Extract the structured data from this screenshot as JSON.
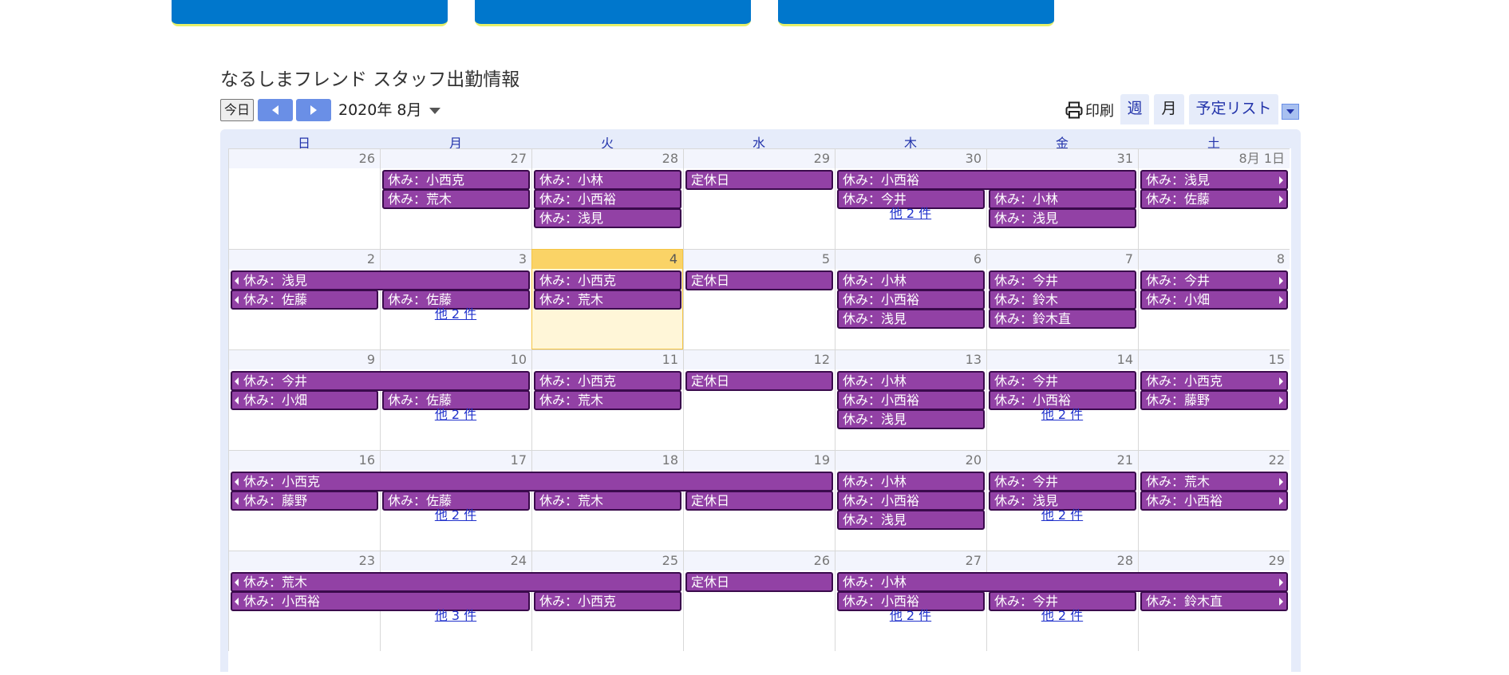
{
  "header": {
    "calendar_title": "なるしまフレンド スタッフ出勤情報"
  },
  "toolbar": {
    "today_label": "今日",
    "month_label": "2020年 8月",
    "print_label": "印刷",
    "week_label": "週",
    "month_view_label": "月",
    "agenda_label": "予定リスト"
  },
  "weekdays": [
    "日",
    "月",
    "火",
    "水",
    "木",
    "金",
    "土"
  ],
  "weeks": [
    {
      "days": [
        "26",
        "27",
        "28",
        "29",
        "30",
        "31",
        "8月 1日"
      ],
      "events": [
        {
          "col": 1,
          "span": 1,
          "row": 0,
          "label": "休み：小西克"
        },
        {
          "col": 1,
          "span": 1,
          "row": 1,
          "label": "休み：荒木"
        },
        {
          "col": 2,
          "span": 1,
          "row": 0,
          "label": "休み：小林"
        },
        {
          "col": 2,
          "span": 1,
          "row": 1,
          "label": "休み：小西裕"
        },
        {
          "col": 2,
          "span": 1,
          "row": 2,
          "label": "休み：浅見"
        },
        {
          "col": 3,
          "span": 1,
          "row": 0,
          "label": "定休日"
        },
        {
          "col": 4,
          "span": 2,
          "row": 0,
          "label": "休み：小西裕"
        },
        {
          "col": 4,
          "span": 1,
          "row": 1,
          "label": "休み：今井"
        },
        {
          "col": 5,
          "span": 1,
          "row": 1,
          "label": "休み：小林"
        },
        {
          "col": 5,
          "span": 1,
          "row": 2,
          "label": "休み：浅見"
        },
        {
          "col": 6,
          "span": 1,
          "row": 0,
          "label": "休み：浅見",
          "cont_right": true
        },
        {
          "col": 6,
          "span": 1,
          "row": 1,
          "label": "休み：佐藤",
          "cont_right": true
        }
      ],
      "more": [
        {
          "col": 4,
          "label": "他 2 件"
        }
      ]
    },
    {
      "days": [
        "2",
        "3",
        "4",
        "5",
        "6",
        "7",
        "8"
      ],
      "events": [
        {
          "col": 0,
          "span": 2,
          "row": 0,
          "label": "休み：浅見",
          "cont_left": true
        },
        {
          "col": 0,
          "span": 1,
          "row": 1,
          "label": "休み：佐藤",
          "cont_left": true
        },
        {
          "col": 1,
          "span": 1,
          "row": 1,
          "label": "休み：佐藤"
        },
        {
          "col": 2,
          "span": 1,
          "row": 0,
          "label": "休み：小西克"
        },
        {
          "col": 2,
          "span": 1,
          "row": 1,
          "label": "休み：荒木"
        },
        {
          "col": 3,
          "span": 1,
          "row": 0,
          "label": "定休日"
        },
        {
          "col": 4,
          "span": 1,
          "row": 0,
          "label": "休み：小林"
        },
        {
          "col": 4,
          "span": 1,
          "row": 1,
          "label": "休み：小西裕"
        },
        {
          "col": 4,
          "span": 1,
          "row": 2,
          "label": "休み：浅見"
        },
        {
          "col": 5,
          "span": 1,
          "row": 0,
          "label": "休み：今井"
        },
        {
          "col": 5,
          "span": 1,
          "row": 1,
          "label": "休み：鈴木"
        },
        {
          "col": 5,
          "span": 1,
          "row": 2,
          "label": "休み：鈴木直"
        },
        {
          "col": 6,
          "span": 1,
          "row": 0,
          "label": "休み：今井",
          "cont_right": true
        },
        {
          "col": 6,
          "span": 1,
          "row": 1,
          "label": "休み：小畑",
          "cont_right": true
        }
      ],
      "more": [
        {
          "col": 1,
          "label": "他 2 件"
        }
      ]
    },
    {
      "days": [
        "9",
        "10",
        "11",
        "12",
        "13",
        "14",
        "15"
      ],
      "events": [
        {
          "col": 0,
          "span": 2,
          "row": 0,
          "label": "休み：今井",
          "cont_left": true
        },
        {
          "col": 0,
          "span": 1,
          "row": 1,
          "label": "休み：小畑",
          "cont_left": true
        },
        {
          "col": 1,
          "span": 1,
          "row": 1,
          "label": "休み：佐藤"
        },
        {
          "col": 2,
          "span": 1,
          "row": 0,
          "label": "休み：小西克"
        },
        {
          "col": 2,
          "span": 1,
          "row": 1,
          "label": "休み：荒木"
        },
        {
          "col": 3,
          "span": 1,
          "row": 0,
          "label": "定休日"
        },
        {
          "col": 4,
          "span": 1,
          "row": 0,
          "label": "休み：小林"
        },
        {
          "col": 4,
          "span": 1,
          "row": 1,
          "label": "休み：小西裕"
        },
        {
          "col": 4,
          "span": 1,
          "row": 2,
          "label": "休み：浅見"
        },
        {
          "col": 5,
          "span": 1,
          "row": 0,
          "label": "休み：今井"
        },
        {
          "col": 5,
          "span": 1,
          "row": 1,
          "label": "休み：小西裕"
        },
        {
          "col": 6,
          "span": 1,
          "row": 0,
          "label": "休み：小西克",
          "cont_right": true
        },
        {
          "col": 6,
          "span": 1,
          "row": 1,
          "label": "休み：藤野",
          "cont_right": true
        }
      ],
      "more": [
        {
          "col": 1,
          "label": "他 2 件"
        },
        {
          "col": 5,
          "label": "他 2 件"
        }
      ]
    },
    {
      "days": [
        "16",
        "17",
        "18",
        "19",
        "20",
        "21",
        "22"
      ],
      "events": [
        {
          "col": 0,
          "span": 4,
          "row": 0,
          "label": "休み：小西克",
          "cont_left": true
        },
        {
          "col": 0,
          "span": 1,
          "row": 1,
          "label": "休み：藤野",
          "cont_left": true
        },
        {
          "col": 1,
          "span": 1,
          "row": 1,
          "label": "休み：佐藤"
        },
        {
          "col": 2,
          "span": 1,
          "row": 1,
          "label": "休み：荒木"
        },
        {
          "col": 3,
          "span": 1,
          "row": 1,
          "label": "定休日"
        },
        {
          "col": 4,
          "span": 1,
          "row": 0,
          "label": "休み：小林"
        },
        {
          "col": 4,
          "span": 1,
          "row": 1,
          "label": "休み：小西裕"
        },
        {
          "col": 4,
          "span": 1,
          "row": 2,
          "label": "休み：浅見"
        },
        {
          "col": 5,
          "span": 1,
          "row": 0,
          "label": "休み：今井"
        },
        {
          "col": 5,
          "span": 1,
          "row": 1,
          "label": "休み：浅見"
        },
        {
          "col": 6,
          "span": 1,
          "row": 0,
          "label": "休み：荒木",
          "cont_right": true
        },
        {
          "col": 6,
          "span": 1,
          "row": 1,
          "label": "休み：小西裕",
          "cont_right": true
        }
      ],
      "more": [
        {
          "col": 1,
          "label": "他 2 件"
        },
        {
          "col": 5,
          "label": "他 2 件"
        }
      ]
    },
    {
      "days": [
        "23",
        "24",
        "25",
        "26",
        "27",
        "28",
        "29"
      ],
      "events": [
        {
          "col": 0,
          "span": 3,
          "row": 0,
          "label": "休み：荒木",
          "cont_left": true
        },
        {
          "col": 0,
          "span": 2,
          "row": 1,
          "label": "休み：小西裕",
          "cont_left": true
        },
        {
          "col": 2,
          "span": 1,
          "row": 1,
          "label": "休み：小西克"
        },
        {
          "col": 3,
          "span": 1,
          "row": 0,
          "label": "定休日"
        },
        {
          "col": 4,
          "span": 3,
          "row": 0,
          "label": "休み：小林",
          "cont_right": true
        },
        {
          "col": 4,
          "span": 1,
          "row": 1,
          "label": "休み：小西裕"
        },
        {
          "col": 5,
          "span": 1,
          "row": 1,
          "label": "休み：今井"
        },
        {
          "col": 6,
          "span": 1,
          "row": 1,
          "label": "休み：鈴木直",
          "cont_right": true
        }
      ],
      "more": [
        {
          "col": 1,
          "label": "他 3 件"
        },
        {
          "col": 4,
          "label": "他 2 件"
        },
        {
          "col": 5,
          "label": "他 2 件"
        }
      ]
    }
  ],
  "colors": {
    "event_bg": "#9241a5",
    "event_border": "#3a0a4c",
    "today_bg": "#fff6d8",
    "today_head": "#fad366",
    "nav_blue": "#6a8fe6",
    "header_button_blue": "#0077cc"
  },
  "today_cell": {
    "week": 1,
    "col": 2
  },
  "icons": {
    "prev": "triangle-left-icon",
    "next": "triangle-right-icon",
    "print": "printer-icon",
    "dropdown": "chevron-down-icon"
  }
}
